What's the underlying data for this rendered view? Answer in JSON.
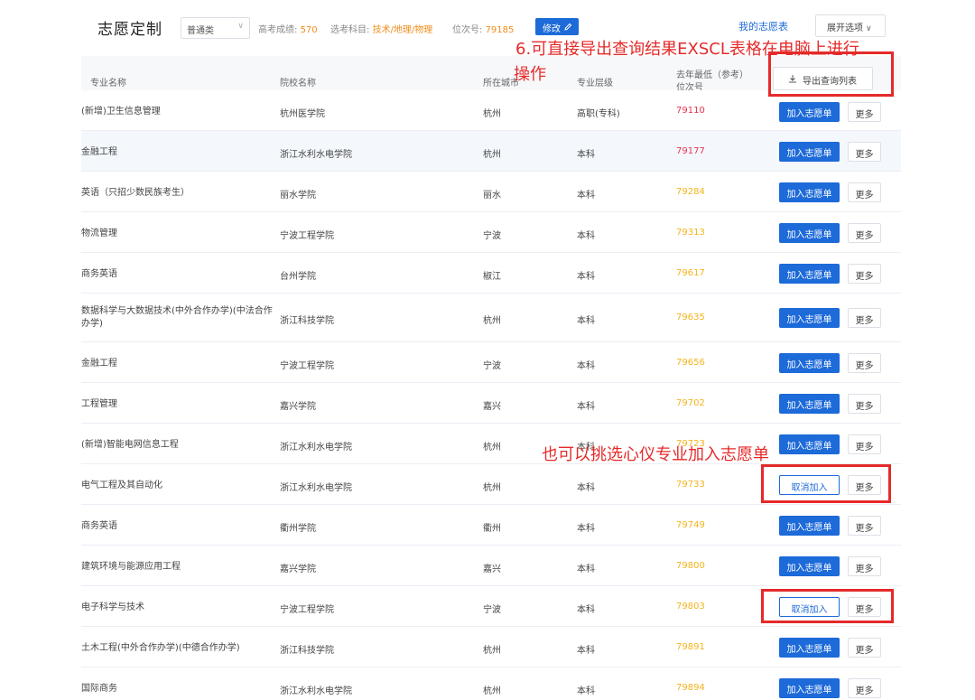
{
  "topbar": {
    "title": "志愿定制",
    "type_select": "普通类",
    "score_label": "高考成绩:",
    "score_value": "570",
    "subjects_label": "选考科目:",
    "subjects_value": "技术/地理/物理",
    "rank_label": "位次号:",
    "rank_value": "79185",
    "modify_label": "修改",
    "my_list_label": "我的志愿表",
    "expand_label": "展开选项"
  },
  "header": {
    "col_major": "专业名称",
    "col_school": "院校名称",
    "col_city": "所在城市",
    "col_level": "专业层级",
    "col_rank_line1": "去年最低（参考）",
    "col_rank_line2": "位次号",
    "export_label": "导出查询列表"
  },
  "rows": [
    {
      "major": "(新增)卫生信息管理",
      "school": "杭州医学院",
      "city": "杭州",
      "level": "高职(专科)",
      "rank": "79110",
      "rank_color": "red",
      "action": "加入志愿单",
      "more": "更多"
    },
    {
      "major": "金融工程",
      "school": "浙江水利水电学院",
      "city": "杭州",
      "level": "本科",
      "rank": "79177",
      "rank_color": "red",
      "action": "加入志愿单",
      "more": "更多"
    },
    {
      "major": "英语（只招少数民族考生）",
      "school": "丽水学院",
      "city": "丽水",
      "level": "本科",
      "rank": "79284",
      "rank_color": "yellow",
      "action": "加入志愿单",
      "more": "更多"
    },
    {
      "major": "物流管理",
      "school": "宁波工程学院",
      "city": "宁波",
      "level": "本科",
      "rank": "79313",
      "rank_color": "yellow",
      "action": "加入志愿单",
      "more": "更多"
    },
    {
      "major": "商务英语",
      "school": "台州学院",
      "city": "椒江",
      "level": "本科",
      "rank": "79617",
      "rank_color": "yellow",
      "action": "加入志愿单",
      "more": "更多"
    },
    {
      "major": "数据科学与大数据技术(中外合作办学)(中法合作办学)",
      "school": "浙江科技学院",
      "city": "杭州",
      "level": "本科",
      "rank": "79635",
      "rank_color": "yellow",
      "action": "加入志愿单",
      "more": "更多"
    },
    {
      "major": "金融工程",
      "school": "宁波工程学院",
      "city": "宁波",
      "level": "本科",
      "rank": "79656",
      "rank_color": "yellow",
      "action": "加入志愿单",
      "more": "更多"
    },
    {
      "major": "工程管理",
      "school": "嘉兴学院",
      "city": "嘉兴",
      "level": "本科",
      "rank": "79702",
      "rank_color": "yellow",
      "action": "加入志愿单",
      "more": "更多"
    },
    {
      "major": "(新增)智能电网信息工程",
      "school": "浙江水利水电学院",
      "city": "杭州",
      "level": "本科",
      "rank": "79723",
      "rank_color": "yellow",
      "action": "加入志愿单",
      "more": "更多"
    },
    {
      "major": "电气工程及其自动化",
      "school": "浙江水利水电学院",
      "city": "杭州",
      "level": "本科",
      "rank": "79733",
      "rank_color": "yellow",
      "action": "取消加入",
      "more": "更多"
    },
    {
      "major": "商务英语",
      "school": "衢州学院",
      "city": "衢州",
      "level": "本科",
      "rank": "79749",
      "rank_color": "yellow",
      "action": "加入志愿单",
      "more": "更多"
    },
    {
      "major": "建筑环境与能源应用工程",
      "school": "嘉兴学院",
      "city": "嘉兴",
      "level": "本科",
      "rank": "79800",
      "rank_color": "yellow",
      "action": "加入志愿单",
      "more": "更多"
    },
    {
      "major": "电子科学与技术",
      "school": "宁波工程学院",
      "city": "宁波",
      "level": "本科",
      "rank": "79803",
      "rank_color": "yellow",
      "action": "取消加入",
      "more": "更多"
    },
    {
      "major": "土木工程(中外合作办学)(中德合作办学)",
      "school": "浙江科技学院",
      "city": "杭州",
      "level": "本科",
      "rank": "79891",
      "rank_color": "yellow",
      "action": "加入志愿单",
      "more": "更多"
    },
    {
      "major": "国际商务",
      "school": "浙江水利水电学院",
      "city": "杭州",
      "level": "本科",
      "rank": "79894",
      "rank_color": "yellow",
      "action": "加入志愿单",
      "more": "更多"
    }
  ],
  "annotations": {
    "export_note_line1": "6.可直接导出查询结果EXSCL表格在电脑上进行",
    "export_note_line2": "操作",
    "select_note": "也可以挑选心仪专业加入志愿单"
  },
  "colors": {
    "primary": "#1d6ad9",
    "rank_red": "#e8344e",
    "rank_yellow": "#f5b31a",
    "accent_orange": "#f08c1c",
    "annotation_red": "#e52a2a"
  }
}
